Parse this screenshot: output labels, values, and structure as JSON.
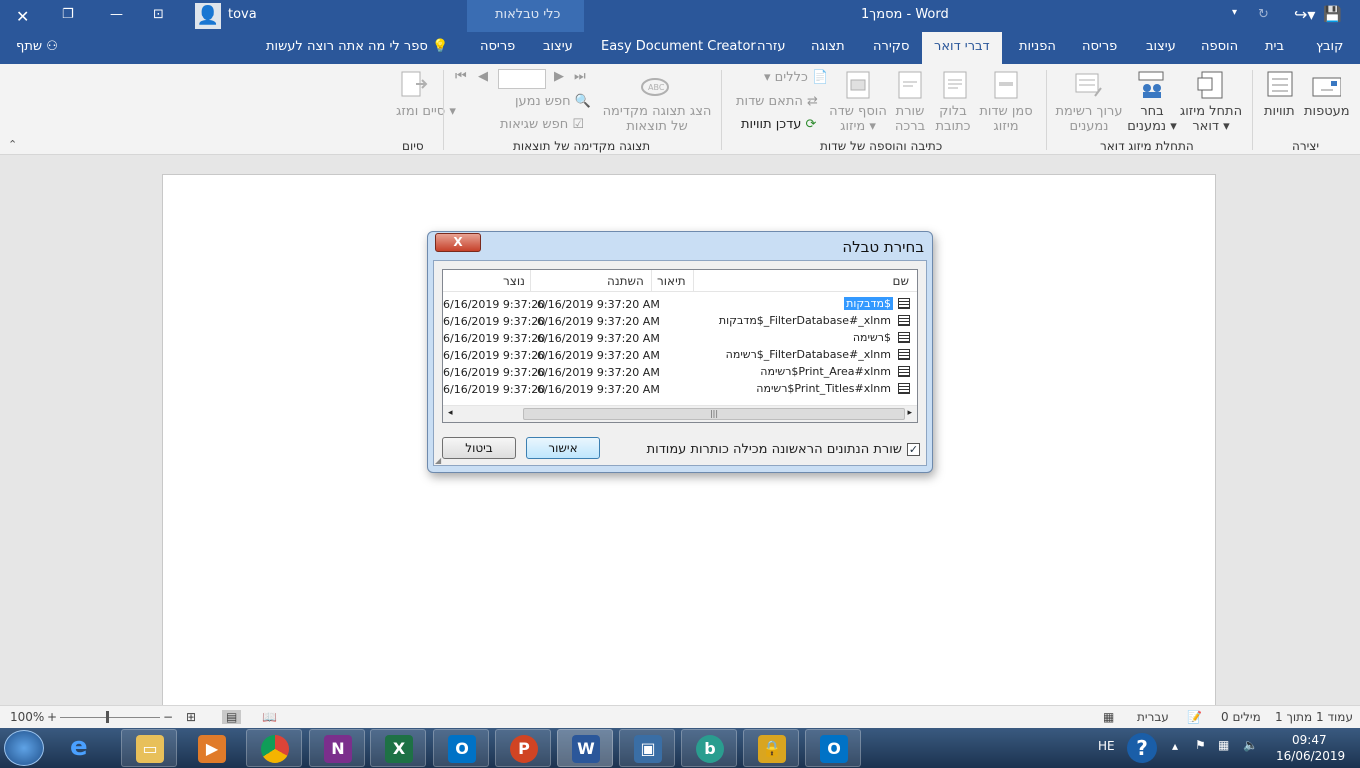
{
  "title_bar": {
    "doc_title": "מסמך1 - Word",
    "contextual_group": "כלי טבלאות",
    "user_name": "tova"
  },
  "tabs": {
    "file": "קובץ",
    "home": "בית",
    "insert": "הוספה",
    "design": "עיצוב",
    "layout": "פריסה",
    "references": "הפניות",
    "mailings": "דברי דואר",
    "review": "סקירה",
    "view": "תצוגה",
    "help": "עזרה",
    "easy_doc": "Easy Document Creator",
    "table_design": "עיצוב",
    "table_layout": "פריסה",
    "tell_me": "ספר לי מה אתה רוצה לעשות",
    "share": "שתף"
  },
  "ribbon": {
    "create": {
      "group_label": "יצירה",
      "envelopes": "מעטפות",
      "labels": "תוויות"
    },
    "start_merge": {
      "group_label": "התחלת מיזוג דואר",
      "start_mail_merge": "התחל מיזוג דואר",
      "select_recipients": "בחר נמענים",
      "edit_recipient_list": "ערוך רשימת נמענים"
    },
    "write_insert": {
      "group_label": "כתיבה והוספה של שדות",
      "highlight_merge_fields": "סמן שדות מיזוג",
      "address_block": "בלוק כתובת",
      "greeting_line": "שורת ברכה",
      "insert_merge_field": "הוסף שדה מיזוג",
      "rules": "כללים",
      "match_fields": "התאם שדות",
      "update_labels": "עדכן תוויות"
    },
    "preview": {
      "group_label": "תצוגה מקדימה של תוצאות",
      "preview_results": "הצג תצוגה מקדימה של תוצאות",
      "find_recipient": "חפש נמען",
      "check_errors": "חפש שגיאות"
    },
    "finish": {
      "group_label": "סיום",
      "finish_merge": "סיים ומזג"
    }
  },
  "dialog": {
    "title": "בחירת טבלה",
    "close_label": "X",
    "columns": {
      "name": "שם",
      "description": "תיאור",
      "modified": "השתנה",
      "created": "נוצר"
    },
    "rows": [
      {
        "name": "מדבקות$",
        "modified": "6/16/2019 9:37:20 AM",
        "created": "6/16/2019 9:37:20",
        "selected": true
      },
      {
        "name": "מדבקות$_FilterDatabase#_xlnm",
        "modified": "6/16/2019 9:37:20 AM",
        "created": "6/16/2019 9:37:20"
      },
      {
        "name": "רשימה$",
        "modified": "6/16/2019 9:37:20 AM",
        "created": "6/16/2019 9:37:20"
      },
      {
        "name": "רשימה$_FilterDatabase#_xlnm",
        "modified": "6/16/2019 9:37:20 AM",
        "created": "6/16/2019 9:37:20"
      },
      {
        "name": "רשימה$Print_Area#xlnm",
        "modified": "6/16/2019 9:37:20 AM",
        "created": "6/16/2019 9:37:20"
      },
      {
        "name": "רשימה$Print_Titles#xlnm",
        "modified": "6/16/2019 9:37:20 AM",
        "created": "6/16/2019 9:37:20"
      }
    ],
    "first_row_headers_label": "שורת הנתונים הראשונה מכילה כותרות עמודות",
    "first_row_headers_checked": true,
    "ok_label": "אישור",
    "cancel_label": "ביטול"
  },
  "status_bar": {
    "page_info": "עמוד 1 מתוך 1",
    "word_count": "0 מילים",
    "language": "עברית",
    "zoom": "100%"
  },
  "taskbar": {
    "apps": [
      "ie",
      "explorer",
      "media-player",
      "chrome",
      "onenote",
      "excel",
      "outlook",
      "powerpoint",
      "word",
      "remote-desktop",
      "app-b",
      "lock",
      "outlook2"
    ],
    "lang": "HE",
    "time": "09:47",
    "date": "16/06/2019"
  }
}
